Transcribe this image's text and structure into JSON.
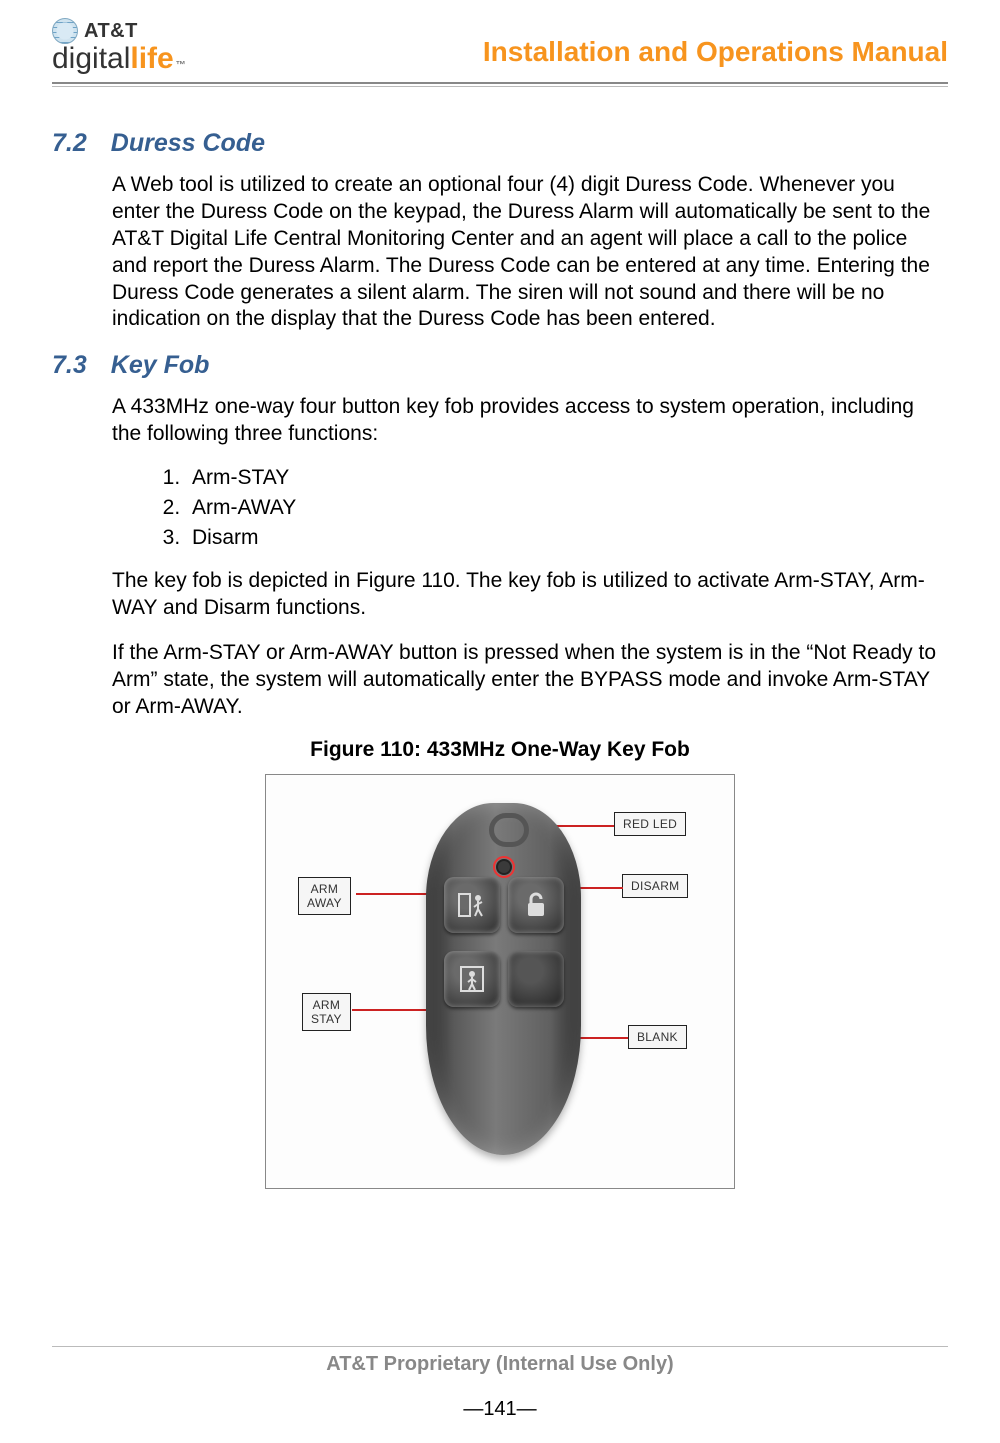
{
  "header": {
    "brand_top": "AT&T",
    "brand_digital": "digital",
    "brand_life": "life",
    "tm": "™",
    "doc_title": "Installation and Operations Manual"
  },
  "sections": {
    "s72": {
      "number": "7.2",
      "title": "Duress Code",
      "p1": "A Web tool is utilized to create an optional four (4) digit Duress Code. Whenever you enter the Duress Code on the keypad, the Duress Alarm will automatically be sent to the AT&T Digital Life Central Monitoring Center and an agent will place a call to the police and report the Duress Alarm. The Duress Code can be entered at any time. Entering the Duress Code generates a silent alarm. The siren will not sound and there will be no indication on the display that the Duress Code has been entered."
    },
    "s73": {
      "number": "7.3",
      "title": "Key Fob",
      "intro": "A 433MHz one-way four button key fob provides access to system operation, including the following three functions:",
      "items": [
        "Arm-STAY",
        "Arm-AWAY",
        "Disarm"
      ],
      "p2": "The key fob is depicted in Figure 110. The key fob is utilized to activate Arm-STAY, Arm-WAY and Disarm functions.",
      "p3": "If the Arm-STAY or Arm-AWAY button is pressed when the system is in the “Not Ready to Arm” state, the system will automatically enter the BYPASS mode and invoke Arm-STAY or Arm-AWAY."
    }
  },
  "figure": {
    "caption": "Figure 110: 433MHz One-Way Key Fob",
    "labels": {
      "arm_away": "ARM\nAWAY",
      "arm_stay": "ARM\nSTAY",
      "red_led": "RED LED",
      "disarm": "DISARM",
      "blank": "BLANK"
    },
    "button_icons": {
      "arm_away": "◻✦",
      "disarm": "🔓",
      "arm_stay": "⛶",
      "blank": ""
    }
  },
  "footer": {
    "proprietary": "AT&T Proprietary (Internal Use Only)",
    "page": "―141―"
  }
}
